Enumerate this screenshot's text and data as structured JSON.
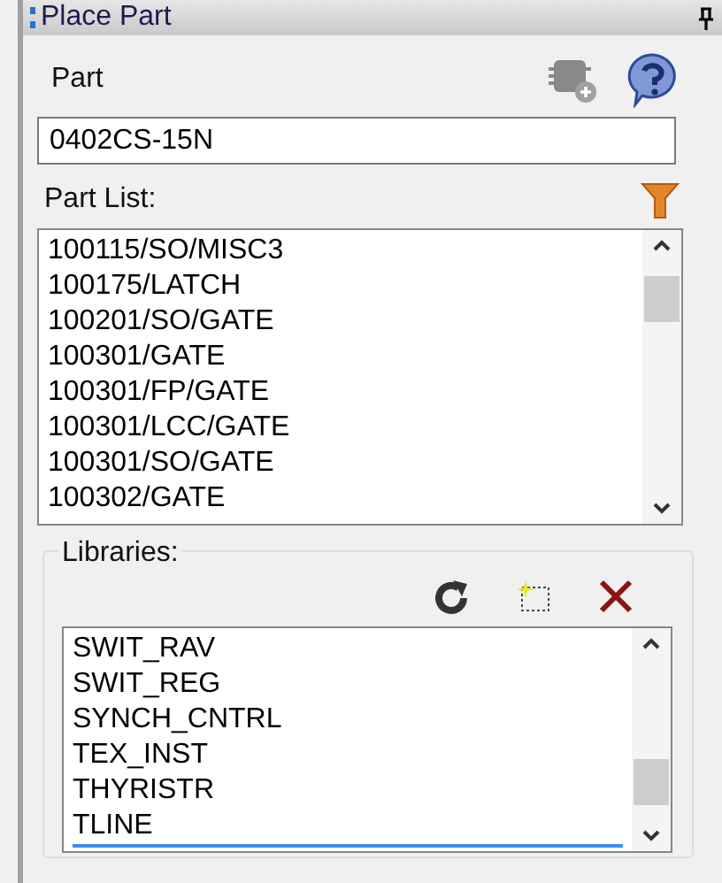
{
  "window": {
    "title": "Place Part"
  },
  "part": {
    "label": "Part",
    "value": "0402CS-15N"
  },
  "part_list": {
    "label": "Part List:",
    "items": [
      "100115/SO/MISC3",
      "100175/LATCH",
      "100201/SO/GATE",
      "100301/GATE",
      "100301/FP/GATE",
      "100301/LCC/GATE",
      "100301/SO/GATE",
      "100302/GATE"
    ]
  },
  "libraries": {
    "label": "Libraries:",
    "items": [
      {
        "label": "SWIT_RAV",
        "selected": false
      },
      {
        "label": "SWIT_REG",
        "selected": false
      },
      {
        "label": "SYNCH_CNTRL",
        "selected": false
      },
      {
        "label": "TEX_INST",
        "selected": false
      },
      {
        "label": "THYRISTR",
        "selected": false
      },
      {
        "label": "TLINE",
        "selected": true
      }
    ]
  }
}
